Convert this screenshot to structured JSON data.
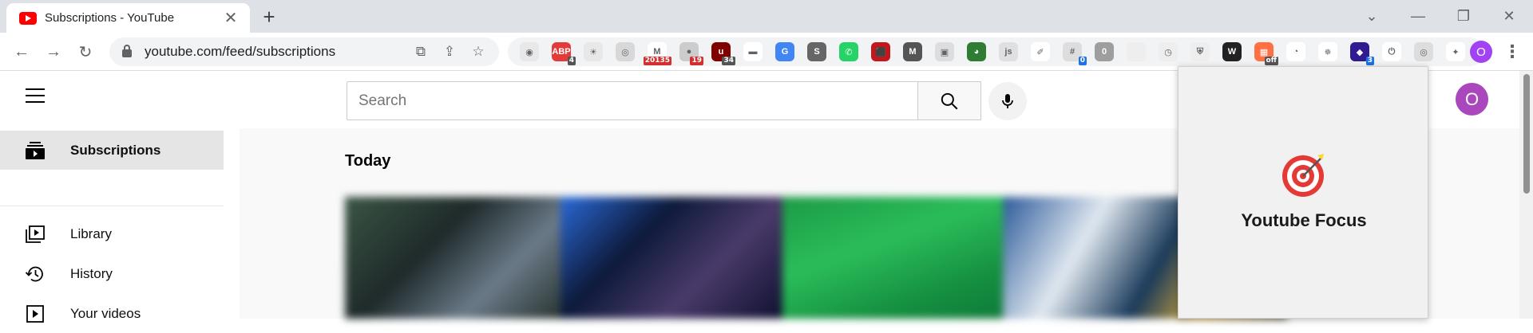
{
  "browser": {
    "tab_title": "Subscriptions - YouTube",
    "url": "youtube.com/feed/subscriptions",
    "profile_initial": "O",
    "extensions": [
      {
        "name": "camera-icon",
        "color": "#e8e8e8",
        "glyph": "◉",
        "badge": ""
      },
      {
        "name": "adblock-icon",
        "color": "#e33b3b",
        "glyph": "ABP",
        "badge": "4"
      },
      {
        "name": "bulb-icon",
        "color": "#e8e8e8",
        "glyph": "☀",
        "badge": ""
      },
      {
        "name": "chat-icon",
        "color": "#d8d8d8",
        "glyph": "◎",
        "badge": ""
      },
      {
        "name": "gmail-icon",
        "color": "#ffffff",
        "glyph": "M",
        "badge": "20135"
      },
      {
        "name": "globe-icon",
        "color": "#cccccc",
        "glyph": "●",
        "badge": "19"
      },
      {
        "name": "ublock-icon",
        "color": "#800000",
        "glyph": "u",
        "badge": "34"
      },
      {
        "name": "mask-icon",
        "color": "#ffffff",
        "glyph": "▬",
        "badge": ""
      },
      {
        "name": "translate-icon",
        "color": "#4285f4",
        "glyph": "G",
        "badge": ""
      },
      {
        "name": "s-icon",
        "color": "#666666",
        "glyph": "S",
        "badge": ""
      },
      {
        "name": "whatsapp-icon",
        "color": "#25d366",
        "glyph": "✆",
        "badge": ""
      },
      {
        "name": "pdf-icon",
        "color": "#c4161c",
        "glyph": "⬛",
        "badge": ""
      },
      {
        "name": "m-icon",
        "color": "#555555",
        "glyph": "M",
        "badge": ""
      },
      {
        "name": "search-ext-icon",
        "color": "#dddddd",
        "glyph": "▣",
        "badge": ""
      },
      {
        "name": "earth-icon",
        "color": "#2e7d32",
        "glyph": "◕",
        "badge": ""
      },
      {
        "name": "js-icon",
        "color": "#e0e0e0",
        "glyph": "js",
        "badge": ""
      },
      {
        "name": "eyedropper-icon",
        "color": "#ffffff",
        "glyph": "✐",
        "badge": ""
      },
      {
        "name": "hash-icon",
        "color": "#dddddd",
        "glyph": "#",
        "badge": "0"
      },
      {
        "name": "zero-icon",
        "color": "#9e9e9e",
        "glyph": "0",
        "badge": ""
      },
      {
        "name": "blank-icon",
        "color": "#eeeeee",
        "glyph": "",
        "badge": ""
      },
      {
        "name": "clock-icon",
        "color": "#eeeeee",
        "glyph": "◷",
        "badge": ""
      },
      {
        "name": "shield-icon",
        "color": "#eeeeee",
        "glyph": "⛨",
        "badge": ""
      },
      {
        "name": "w-icon",
        "color": "#222222",
        "glyph": "W",
        "badge": ""
      },
      {
        "name": "grid-icon",
        "color": "#ff7043",
        "glyph": "▦",
        "badge": "off"
      },
      {
        "name": "spy-icon",
        "color": "#ffffff",
        "glyph": "◔",
        "badge": ""
      },
      {
        "name": "bug-icon",
        "color": "#ffffff",
        "glyph": "✵",
        "badge": ""
      },
      {
        "name": "graduation-icon",
        "color": "#311b92",
        "glyph": "◆",
        "badge": "3"
      },
      {
        "name": "power-icon",
        "color": "#ffffff",
        "glyph": "⏻",
        "badge": ""
      },
      {
        "name": "target-ext-icon",
        "color": "#dddddd",
        "glyph": "◎",
        "badge": ""
      },
      {
        "name": "puzzle-icon",
        "color": "#ffffff",
        "glyph": "✦",
        "badge": ""
      }
    ]
  },
  "youtube": {
    "search_placeholder": "Search",
    "avatar_initial": "O",
    "sidebar": [
      {
        "label": "Subscriptions",
        "active": true
      },
      {
        "label": "Library",
        "active": false
      },
      {
        "label": "History",
        "active": false
      },
      {
        "label": "Your videos",
        "active": false
      }
    ],
    "section_title": "Today"
  },
  "popup": {
    "title": "Youtube Focus"
  }
}
